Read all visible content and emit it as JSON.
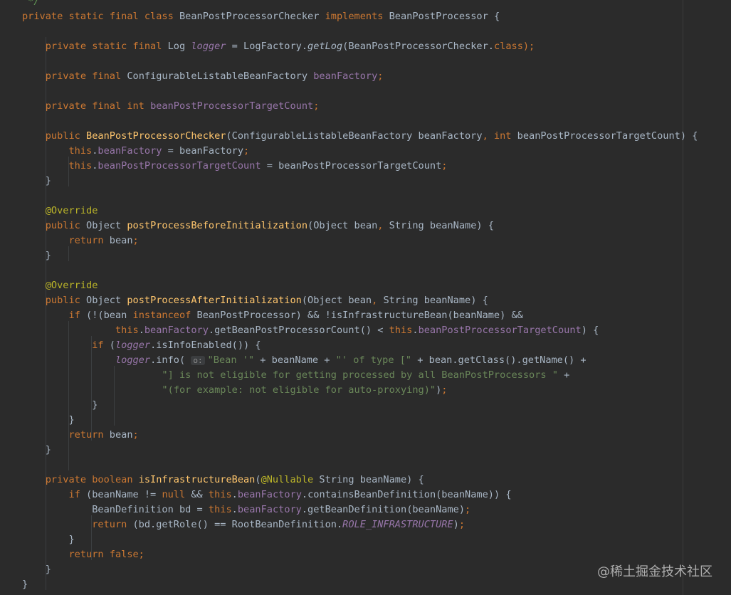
{
  "watermark": "@稀土掘金技术社区",
  "code_lines": [
    [
      [
        "cmt",
        " */"
      ]
    ],
    [
      [
        "kw",
        "private static final class "
      ],
      [
        "plain",
        "BeanPostProcessorChecker "
      ],
      [
        "kw",
        "implements "
      ],
      [
        "plain",
        "BeanPostProcessor {"
      ]
    ],
    [],
    [
      [
        "kw",
        "    private static final "
      ],
      [
        "plain",
        "Log "
      ],
      [
        "field-i",
        "logger"
      ],
      [
        "plain",
        " = LogFactory."
      ],
      [
        "call-i",
        "getLog"
      ],
      [
        "plain",
        "(BeanPostProcessorChecker."
      ],
      [
        "kw",
        "class"
      ],
      [
        "kw",
        ");"
      ]
    ],
    [],
    [
      [
        "kw",
        "    private final "
      ],
      [
        "plain",
        "ConfigurableListableBeanFactory "
      ],
      [
        "field",
        "beanFactory"
      ],
      [
        "kw",
        ";"
      ]
    ],
    [],
    [
      [
        "kw",
        "    private final int "
      ],
      [
        "field",
        "beanPostProcessorTargetCount"
      ],
      [
        "kw",
        ";"
      ]
    ],
    [],
    [
      [
        "kw",
        "    public "
      ],
      [
        "fn",
        "BeanPostProcessorChecker"
      ],
      [
        "plain",
        "(ConfigurableListableBeanFactory beanFactory"
      ],
      [
        "kw",
        ", int "
      ],
      [
        "plain",
        "beanPostProcessorTargetCount) {"
      ]
    ],
    [
      [
        "kw",
        "        this"
      ],
      [
        "plain",
        "."
      ],
      [
        "field",
        "beanFactory"
      ],
      [
        "plain",
        " = beanFactory"
      ],
      [
        "kw",
        ";"
      ]
    ],
    [
      [
        "kw",
        "        this"
      ],
      [
        "plain",
        "."
      ],
      [
        "field",
        "beanPostProcessorTargetCount"
      ],
      [
        "plain",
        " = beanPostProcessorTargetCount"
      ],
      [
        "kw",
        ";"
      ]
    ],
    [
      [
        "plain",
        "    }"
      ]
    ],
    [],
    [
      [
        "ann",
        "    @Override"
      ]
    ],
    [
      [
        "kw",
        "    public "
      ],
      [
        "plain",
        "Object "
      ],
      [
        "fn",
        "postProcessBeforeInitialization"
      ],
      [
        "plain",
        "(Object bean"
      ],
      [
        "kw",
        ", "
      ],
      [
        "plain",
        "String beanName) {"
      ]
    ],
    [
      [
        "kw",
        "        return "
      ],
      [
        "plain",
        "bean"
      ],
      [
        "kw",
        ";"
      ]
    ],
    [
      [
        "plain",
        "    }"
      ]
    ],
    [],
    [
      [
        "ann",
        "    @Override"
      ]
    ],
    [
      [
        "kw",
        "    public "
      ],
      [
        "plain",
        "Object "
      ],
      [
        "fn",
        "postProcessAfterInitialization"
      ],
      [
        "plain",
        "(Object bean"
      ],
      [
        "kw",
        ", "
      ],
      [
        "plain",
        "String beanName) {"
      ]
    ],
    [
      [
        "kw",
        "        if "
      ],
      [
        "plain",
        "(!(bean "
      ],
      [
        "kw",
        "instanceof "
      ],
      [
        "plain",
        "BeanPostProcessor) && !isInfrastructureBean(beanName) &&"
      ]
    ],
    [
      [
        "kw",
        "                this"
      ],
      [
        "plain",
        "."
      ],
      [
        "field",
        "beanFactory"
      ],
      [
        "plain",
        ".getBeanPostProcessorCount() < "
      ],
      [
        "kw",
        "this"
      ],
      [
        "plain",
        "."
      ],
      [
        "field",
        "beanPostProcessorTargetCount"
      ],
      [
        "plain",
        ") {"
      ]
    ],
    [
      [
        "kw",
        "            if "
      ],
      [
        "plain",
        "("
      ],
      [
        "field-i",
        "logger"
      ],
      [
        "plain",
        ".isInfoEnabled()) {"
      ]
    ],
    [
      [
        "field-i",
        "                logger"
      ],
      [
        "plain",
        ".info( "
      ],
      [
        "hint",
        "o:"
      ],
      [
        "str",
        "\"Bean '\""
      ],
      [
        "plain",
        " + beanName + "
      ],
      [
        "str",
        "\"' of type [\""
      ],
      [
        "plain",
        " + bean.getClass().getName() +"
      ]
    ],
    [
      [
        "str",
        "                        \"] is not eligible for getting processed by all BeanPostProcessors \""
      ],
      [
        "plain",
        " +"
      ]
    ],
    [
      [
        "str",
        "                        \"(for example: not eligible for auto-proxying)\""
      ],
      [
        "plain",
        ")"
      ],
      [
        "kw",
        ";"
      ]
    ],
    [
      [
        "plain",
        "            }"
      ]
    ],
    [
      [
        "plain",
        "        }"
      ]
    ],
    [
      [
        "kw",
        "        return "
      ],
      [
        "plain",
        "bean"
      ],
      [
        "kw",
        ";"
      ]
    ],
    [
      [
        "plain",
        "    }"
      ]
    ],
    [],
    [
      [
        "kw",
        "    private boolean "
      ],
      [
        "fn",
        "isInfrastructureBean"
      ],
      [
        "plain",
        "("
      ],
      [
        "ann",
        "@Nullable "
      ],
      [
        "plain",
        "String beanName) {"
      ]
    ],
    [
      [
        "kw",
        "        if "
      ],
      [
        "plain",
        "(beanName != "
      ],
      [
        "kw",
        "null "
      ],
      [
        "plain",
        "&& "
      ],
      [
        "kw",
        "this"
      ],
      [
        "plain",
        "."
      ],
      [
        "field",
        "beanFactory"
      ],
      [
        "plain",
        ".containsBeanDefinition(beanName)) {"
      ]
    ],
    [
      [
        "plain",
        "            BeanDefinition bd = "
      ],
      [
        "kw",
        "this"
      ],
      [
        "plain",
        "."
      ],
      [
        "field",
        "beanFactory"
      ],
      [
        "plain",
        ".getBeanDefinition(beanName)"
      ],
      [
        "kw",
        ";"
      ]
    ],
    [
      [
        "kw",
        "            return "
      ],
      [
        "plain",
        "(bd.getRole() == RootBeanDefinition."
      ],
      [
        "field-i",
        "ROLE_INFRASTRUCTURE"
      ],
      [
        "plain",
        ")"
      ],
      [
        "kw",
        ";"
      ]
    ],
    [
      [
        "plain",
        "        }"
      ]
    ],
    [
      [
        "kw",
        "        return false;"
      ]
    ],
    [
      [
        "plain",
        "    }"
      ]
    ],
    [
      [
        "plain",
        "}"
      ]
    ]
  ]
}
